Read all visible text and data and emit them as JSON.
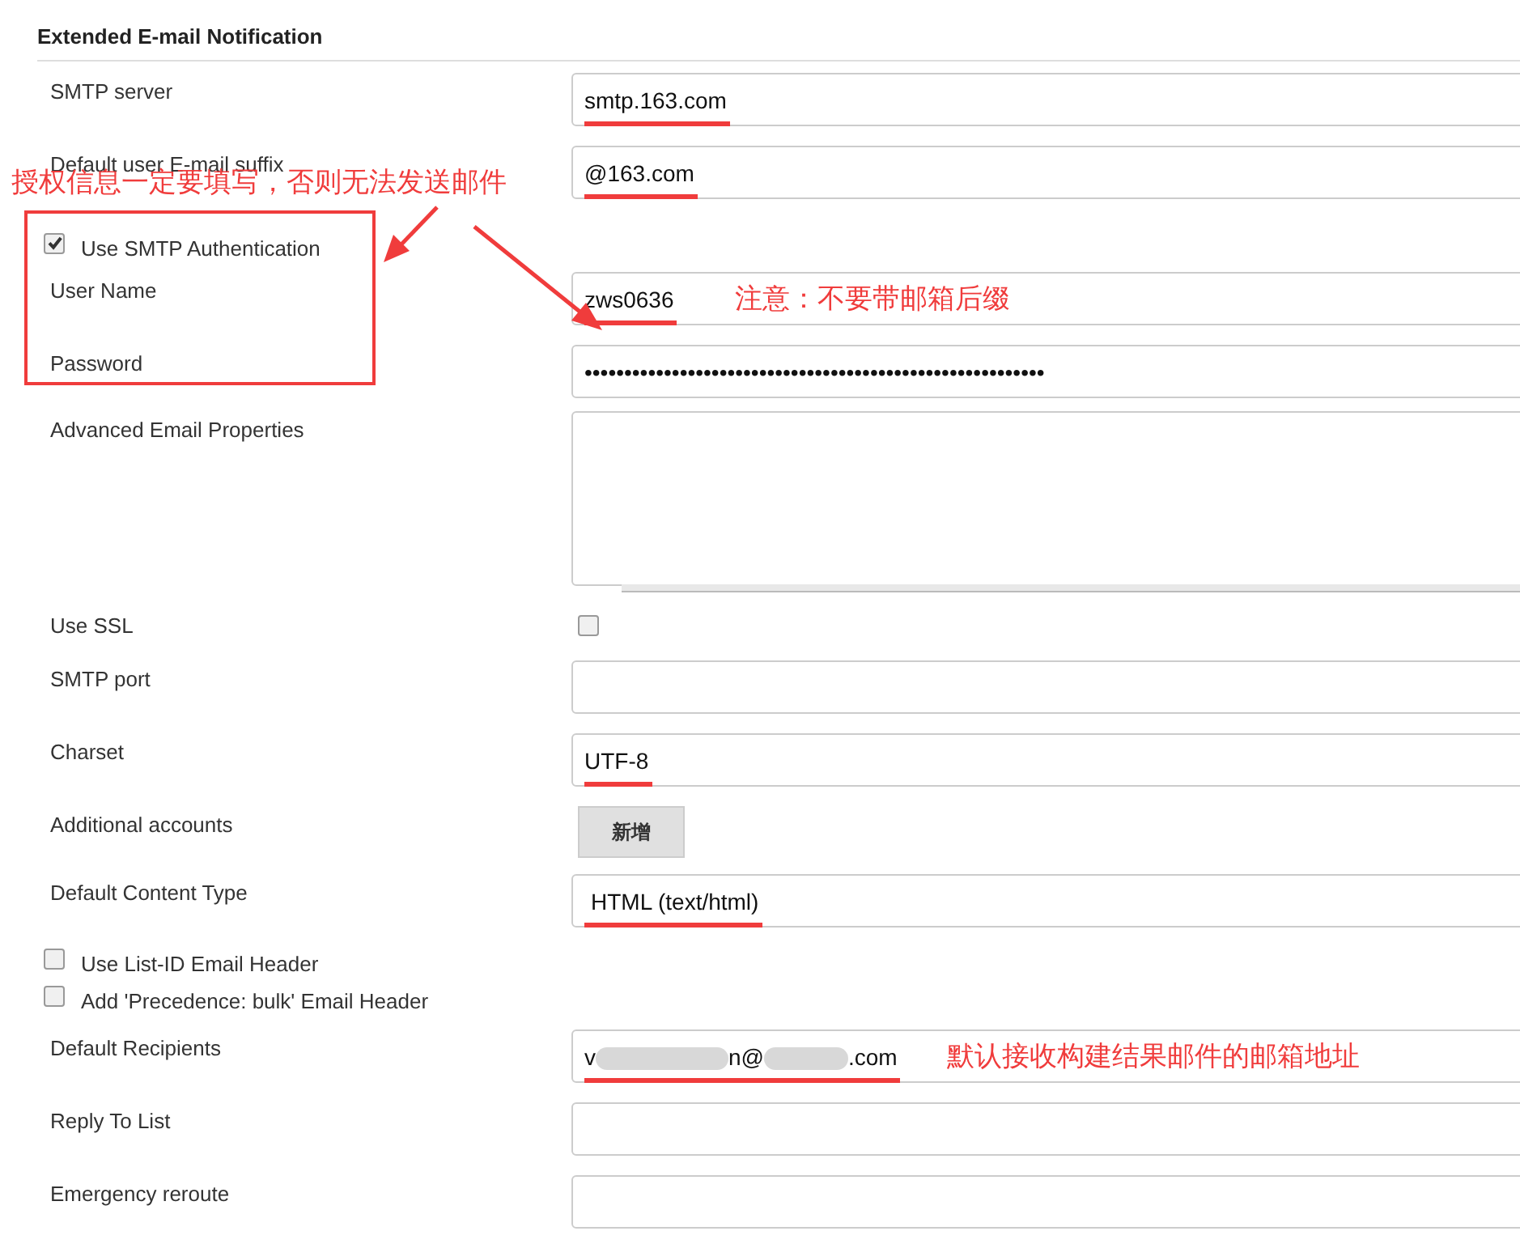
{
  "section_title": "Extended E-mail Notification",
  "callout": {
    "text": "授权信息一定要填写，否则无法发送邮件"
  },
  "fields": [
    {
      "kind": "text",
      "label": "SMTP server",
      "value": "smtp.163.com",
      "underlined": true
    },
    {
      "kind": "text",
      "label": "Default user E-mail suffix",
      "value": "@163.com",
      "underlined": true
    },
    {
      "kind": "checkbox",
      "label": "Use SMTP Authentication",
      "checked": true
    },
    {
      "kind": "text",
      "label": "User Name",
      "value": "zws0636",
      "underlined": true,
      "note": "注意：不要带邮箱后缀"
    },
    {
      "kind": "text",
      "label": "Password",
      "value": "••••••••••••••••••••••••••••••••••••••••••••••••••••••••••",
      "underlined": false
    },
    {
      "kind": "textarea",
      "label": "Advanced Email Properties"
    },
    {
      "kind": "toggle",
      "label": "Use SSL",
      "checked": false
    },
    {
      "kind": "text",
      "label": "SMTP port"
    },
    {
      "kind": "text",
      "label": "Charset",
      "value": "UTF-8",
      "underlined": true
    },
    {
      "kind": "button",
      "label": "Additional accounts",
      "button": "新增"
    },
    {
      "kind": "text",
      "label": "Default Content Type",
      "value": "HTML (text/html)",
      "underlined": true
    },
    {
      "kind": "checkbox",
      "label": "Use List-ID Email Header",
      "checked": false
    },
    {
      "kind": "checkbox",
      "label": "Add 'Precedence: bulk' Email Header",
      "checked": false
    },
    {
      "kind": "blurred",
      "label": "Default Recipients",
      "value_parts": [
        "v",
        "n@",
        ".com"
      ],
      "underlined": true,
      "note": "默认接收构建结果邮件的邮箱地址"
    },
    {
      "kind": "text",
      "label": "Reply To List"
    },
    {
      "kind": "text",
      "label": "Emergency reroute"
    }
  ]
}
